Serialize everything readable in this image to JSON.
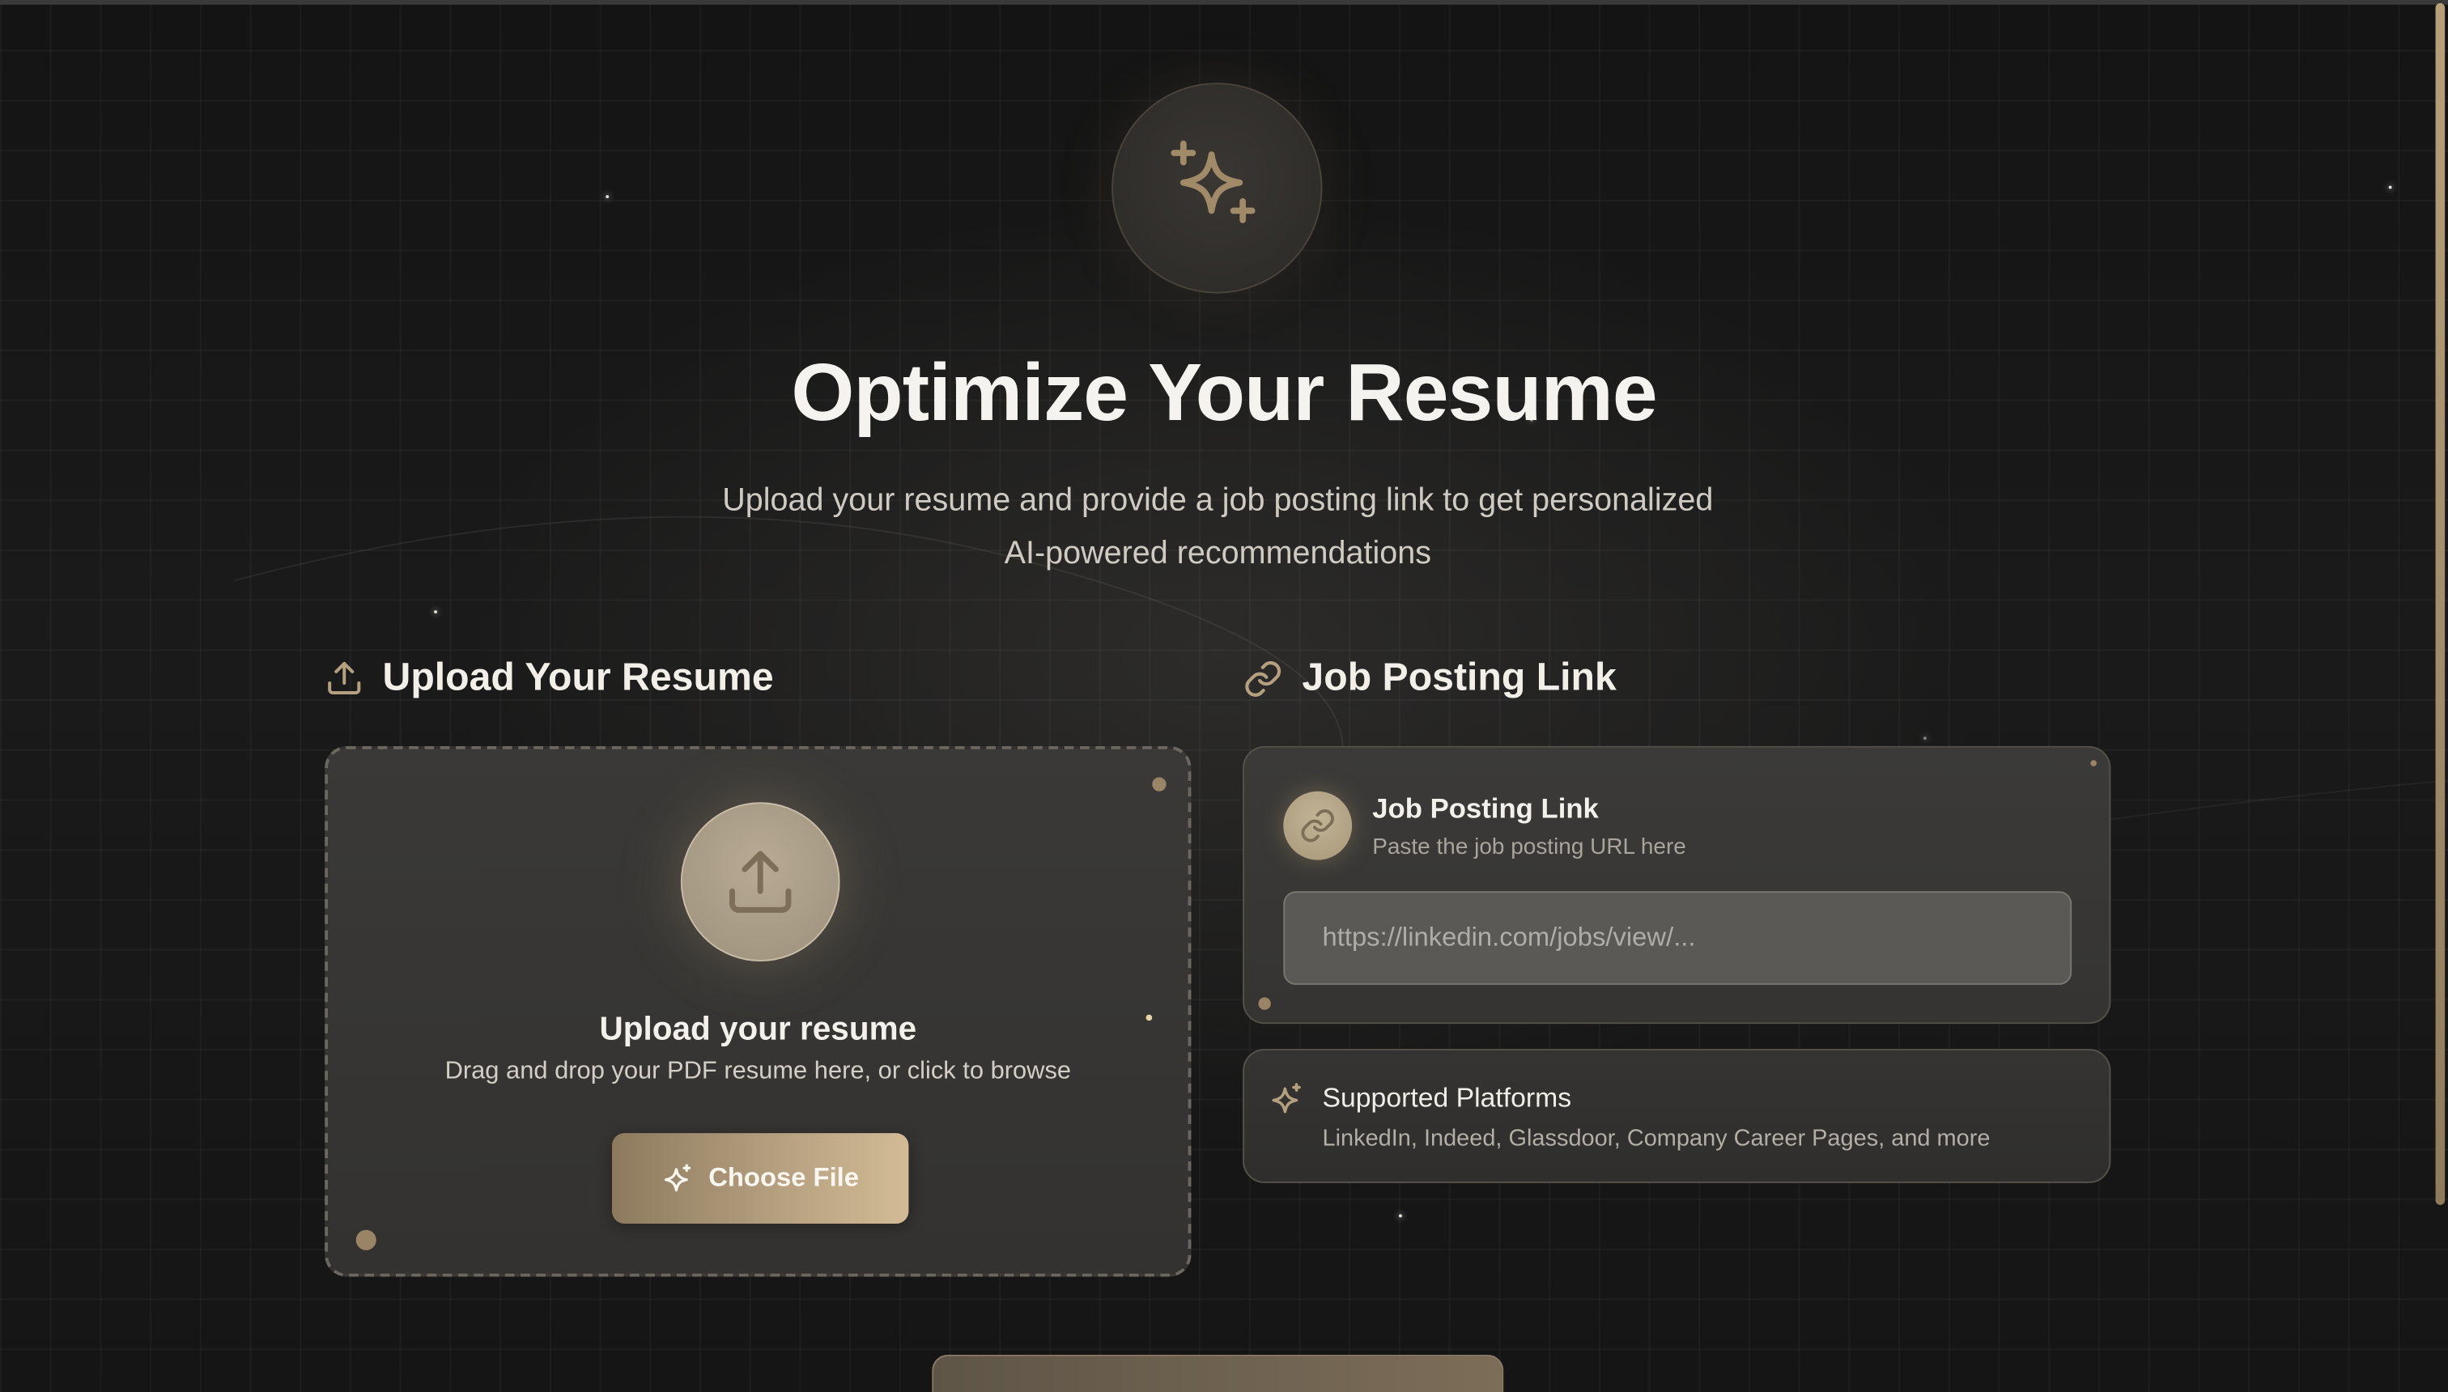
{
  "hero": {
    "badge_icon": "sparkles-icon",
    "title": "Optimize Your Resume",
    "subtitle_line1": "Upload your resume and provide a job posting link to get personalized",
    "subtitle_line2": "AI-powered recommendations"
  },
  "upload_section": {
    "heading": "Upload Your Resume",
    "heading_icon": "upload-icon",
    "card_title": "Upload your resume",
    "card_desc": "Drag and drop your PDF resume here, or click to browse",
    "button_label": "Choose File",
    "button_icon": "sparkles-icon"
  },
  "job_section": {
    "heading": "Job Posting Link",
    "heading_icon": "link-icon",
    "card_title": "Job Posting Link",
    "card_subtitle": "Paste the job posting URL here",
    "input_placeholder": "https://linkedin.com/jobs/view/...",
    "input_value": ""
  },
  "platforms": {
    "title": "Supported Platforms",
    "desc": "LinkedIn, Indeed, Glassdoor, Company Career Pages, and more",
    "icon": "sparkles-icon"
  },
  "colors": {
    "accent_gold": "#b49f7f",
    "background": "#141414",
    "card": "#3a3937"
  }
}
